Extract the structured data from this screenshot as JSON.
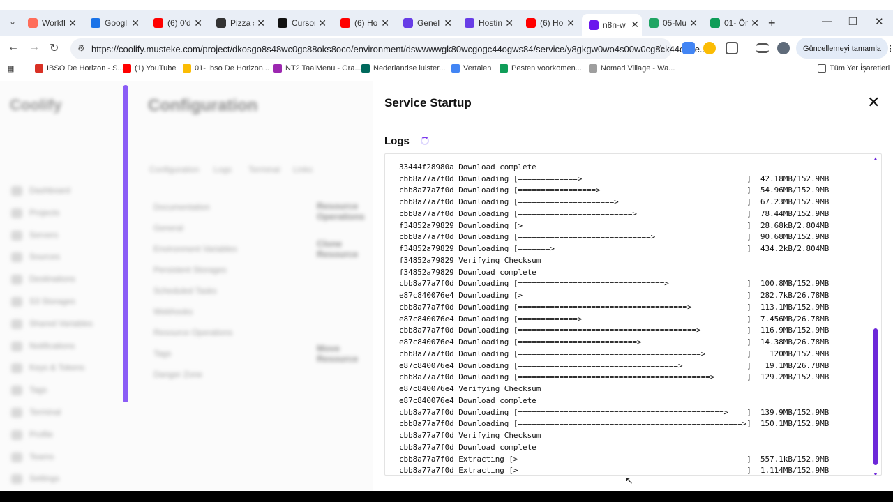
{
  "browser": {
    "tabs": [
      {
        "title": "Workfl",
        "icon": "workflow-icon",
        "color": "#ff6d5a"
      },
      {
        "title": "Googl",
        "icon": "google-calendar-icon",
        "color": "#1a73e8"
      },
      {
        "title": "(6) 0'd",
        "icon": "youtube-icon",
        "color": "#ff0000"
      },
      {
        "title": "Pizza s",
        "icon": "openai-icon",
        "color": "#333333"
      },
      {
        "title": "Cursor",
        "icon": "cursor-icon",
        "color": "#111111"
      },
      {
        "title": "(6) Ho",
        "icon": "youtube-icon",
        "color": "#ff0000"
      },
      {
        "title": "Genel",
        "icon": "hostinger-icon",
        "color": "#673de6"
      },
      {
        "title": "Hostin",
        "icon": "hostinger-icon",
        "color": "#673de6"
      },
      {
        "title": "(6) Ho",
        "icon": "youtube-icon",
        "color": "#ff0000"
      },
      {
        "title": "n8n-w",
        "icon": "coolify-icon",
        "color": "#6b16ed",
        "active": true
      },
      {
        "title": "05-Mu",
        "icon": "google-drive-icon",
        "color": "#1fa463"
      },
      {
        "title": "01- Ön",
        "icon": "google-sheets-icon",
        "color": "#0f9d58"
      }
    ],
    "url": "https://coolify.musteke.com/project/dkosgo8s48wc0gc88oks8oco/environment/dswwwwgk80wcgogc44ogws84/service/y8gkgw0wo4s00w0cg8ck44oc/re...",
    "update_button": "Güncellemeyi tamamla",
    "bookmarks": [
      {
        "label": "IBSO De Horizon - S...",
        "color": "#d93025"
      },
      {
        "label": "(1) YouTube",
        "color": "#ff0000"
      },
      {
        "label": "01- Ibso De Horizon...",
        "color": "#fbbc04"
      },
      {
        "label": "NT2 TaalMenu - Gra...",
        "color": "#9c27b0"
      },
      {
        "label": "Nederlandse luister...",
        "color": "#00695c"
      },
      {
        "label": "Vertalen",
        "color": "#4285f4"
      },
      {
        "label": "Pesten voorkomen...",
        "color": "#0f9d58"
      },
      {
        "label": "Nomad Village - Wa...",
        "color": "#9e9e9e"
      }
    ],
    "all_bookmarks": "Tüm Yer İşaretleri"
  },
  "background": {
    "logo": "Coolify",
    "page_title": "Configuration",
    "sidebar": [
      "Dashboard",
      "Projects",
      "Servers",
      "Sources",
      "Destinations",
      "S3 Storages",
      "Shared Variables",
      "Notifications",
      "Keys & Tokens",
      "Tags",
      "Terminal",
      "Profile",
      "Teams",
      "Settings"
    ],
    "tabs": [
      "Configuration",
      "Logs",
      "Terminal",
      "Links"
    ],
    "subnav": [
      "Documentation",
      "General",
      "Environment Variables",
      "Persistent Storages",
      "Scheduled Tasks",
      "Webhooks",
      "Resource Operations",
      "Tags",
      "Danger Zone"
    ],
    "blocks": [
      "Resource Operations",
      "Clone Resource",
      "Move Resource"
    ]
  },
  "modal": {
    "title": "Service Startup",
    "logs_title": "Logs",
    "log_lines": [
      "33444f28980a Download complete",
      "cbb8a77a7f0d Downloading [=============>                                    ]  42.18MB/152.9MB",
      "cbb8a77a7f0d Downloading [=================>                                ]  54.96MB/152.9MB",
      "cbb8a77a7f0d Downloading [=====================>                            ]  67.23MB/152.9MB",
      "cbb8a77a7f0d Downloading [=========================>                        ]  78.44MB/152.9MB",
      "f34852a79829 Downloading [>                                                 ]  28.68kB/2.804MB",
      "cbb8a77a7f0d Downloading [=============================>                    ]  90.68MB/152.9MB",
      "f34852a79829 Downloading [=======>                                          ]  434.2kB/2.804MB",
      "f34852a79829 Verifying Checksum",
      "f34852a79829 Download complete",
      "cbb8a77a7f0d Downloading [================================>                 ]  100.8MB/152.9MB",
      "e87c840076e4 Downloading [>                                                 ]  282.7kB/26.78MB",
      "cbb8a77a7f0d Downloading [=====================================>            ]  113.1MB/152.9MB",
      "e87c840076e4 Downloading [=============>                                    ]  7.456MB/26.78MB",
      "cbb8a77a7f0d Downloading [=======================================>          ]  116.9MB/152.9MB",
      "e87c840076e4 Downloading [==========================>                       ]  14.38MB/26.78MB",
      "cbb8a77a7f0d Downloading [========================================>         ]    120MB/152.9MB",
      "e87c840076e4 Downloading [===================================>              ]   19.1MB/26.78MB",
      "cbb8a77a7f0d Downloading [==========================================>       ]  129.2MB/152.9MB",
      "e87c840076e4 Verifying Checksum",
      "e87c840076e4 Download complete",
      "cbb8a77a7f0d Downloading [=============================================>    ]  139.9MB/152.9MB",
      "cbb8a77a7f0d Downloading [=================================================>]  150.1MB/152.9MB",
      "cbb8a77a7f0d Verifying Checksum",
      "cbb8a77a7f0d Download complete",
      "cbb8a77a7f0d Extracting [>                                                  ]  557.1kB/152.9MB",
      "cbb8a77a7f0d Extracting [>                                                  ]  1.114MB/152.9MB"
    ]
  }
}
